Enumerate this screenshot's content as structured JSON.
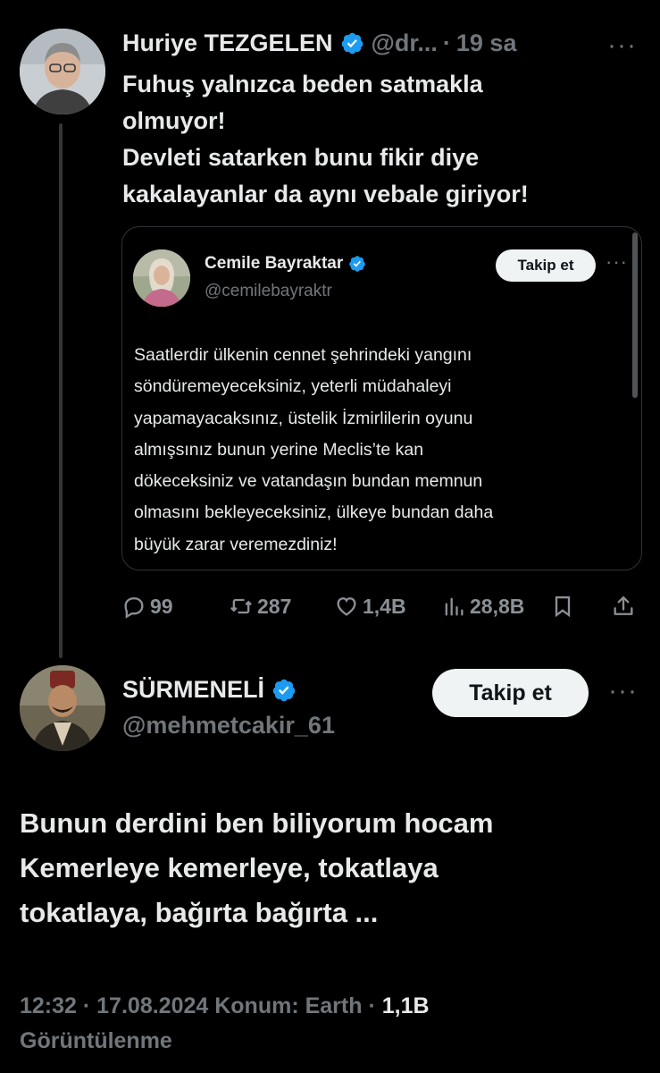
{
  "parent_tweet": {
    "author_name": "Huriye TEZGELEN",
    "handle": "@dr...",
    "separator": "·",
    "time": "19 sa",
    "more_label": "···",
    "text_lines": [
      "Fuhuş yalnızca beden satmakla",
      "olmuyor!",
      "Devleti satarken bunu fikir diye",
      "kakalayanlar da aynı vebale giriyor!"
    ],
    "quote": {
      "author_name": "Cemile Bayraktar",
      "handle": "@cemilebayraktr",
      "follow_label": "Takip et",
      "more_label": "···",
      "text_lines": [
        "Saatlerdir ülkenin cennet şehrindeki yangını",
        "söndüremeyeceksiniz, yeterli müdahaleyi",
        "yapamayacaksınız, üstelik İzmirlilerin oyunu",
        "almışsınız bunun yerine Meclis’te kan",
        "dökeceksiniz ve vatandaşın bundan memnun",
        "olmasını bekleyeceksiniz, ülkeye bundan daha",
        "büyük zarar veremezdiniz!"
      ]
    },
    "actions": {
      "replies": "99",
      "reposts": "287",
      "likes": "1,4B",
      "views": "28,8B"
    }
  },
  "main_tweet": {
    "author_name": "SÜRMENELİ",
    "handle": "@mehmetcakir_61",
    "follow_label": "Takip et",
    "more_label": "···",
    "text_lines": [
      "Bunun derdini ben biliyorum hocam",
      "Kemerleye kemerleye, tokatlaya",
      "tokatlaya, bağırta bağırta ..."
    ],
    "meta_line1": "12:32 · 17.08.2024 Konum: Earth · ",
    "views_count": "1,1B",
    "views_label": "Görüntülenme"
  },
  "colors": {
    "background": "#000000",
    "text": "#e7e9ea",
    "secondary": "#71767b",
    "verified_blue": "#1d9bf0",
    "button_bg": "#eff3f4"
  }
}
